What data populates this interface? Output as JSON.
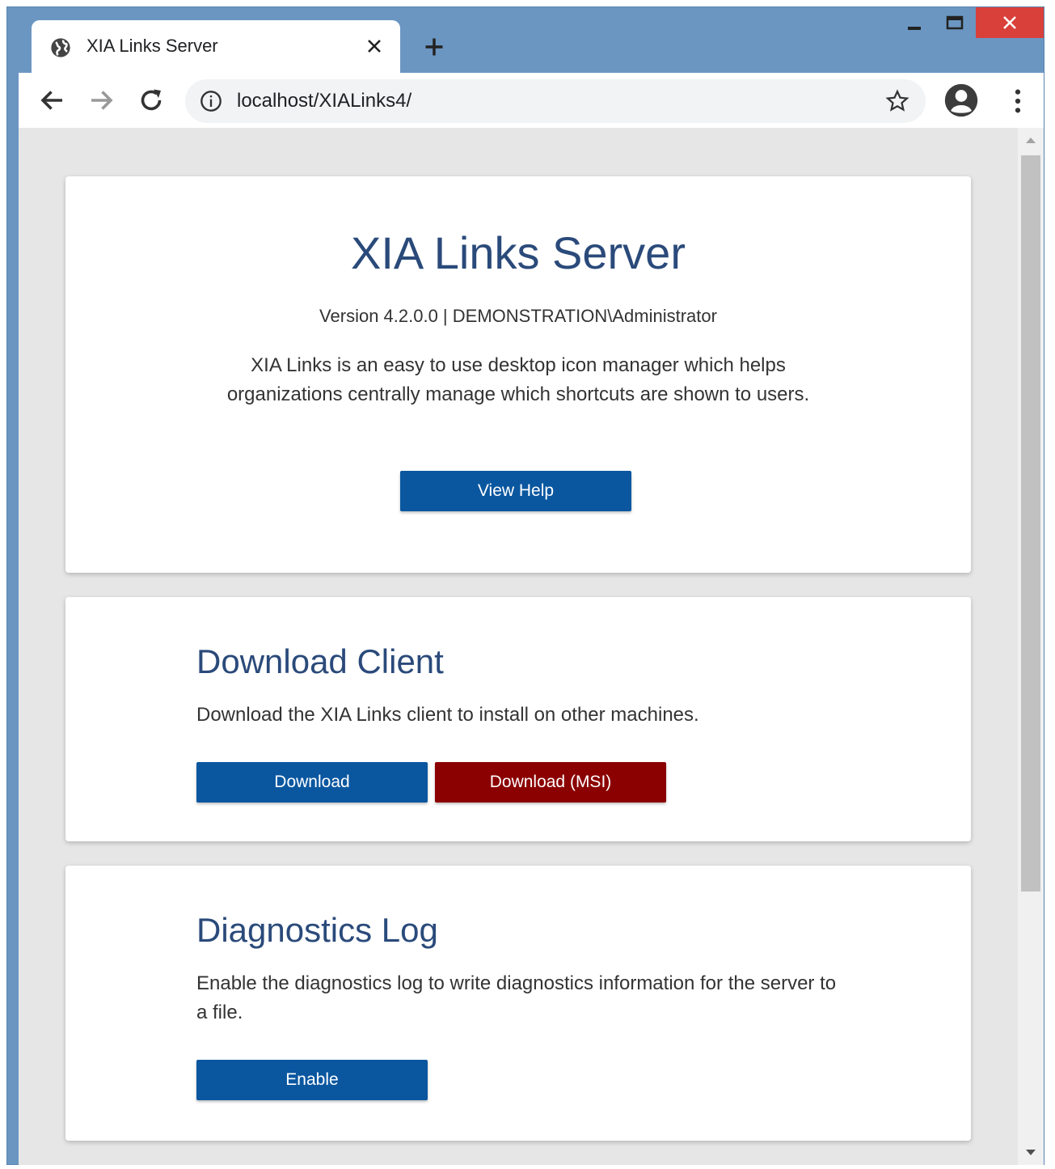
{
  "browser": {
    "tab_title": "XIA Links Server",
    "url": "localhost/XIALinks4/"
  },
  "hero": {
    "title": "XIA Links Server",
    "version": "Version 4.2.0.0 | DEMONSTRATION\\Administrator",
    "description": "XIA Links is an easy to use desktop icon manager which helps organizations centrally manage which shortcuts are shown to users.",
    "help_button": "View Help"
  },
  "download": {
    "title": "Download Client",
    "description": "Download the XIA Links client to install on other machines.",
    "download_button": "Download",
    "msi_button": "Download (MSI)"
  },
  "diagnostics": {
    "title": "Diagnostics Log",
    "description": "Enable the diagnostics log to write diagnostics information for the server to a file.",
    "enable_button": "Enable"
  },
  "icons": {
    "favicon": "globe-icon",
    "tab_close": "close-icon",
    "new_tab": "plus-icon",
    "back": "arrow-left-icon",
    "forward": "arrow-right-icon",
    "reload": "reload-icon",
    "info": "info-icon",
    "bookmark": "star-icon",
    "profile": "account-icon",
    "menu": "more-vert-icon"
  },
  "colors": {
    "primary_button": "#0a57a0",
    "danger_button": "#8b0000",
    "heading": "#2a4a7a",
    "window_frame": "#6b96c2",
    "close_button": "#d9403a"
  }
}
